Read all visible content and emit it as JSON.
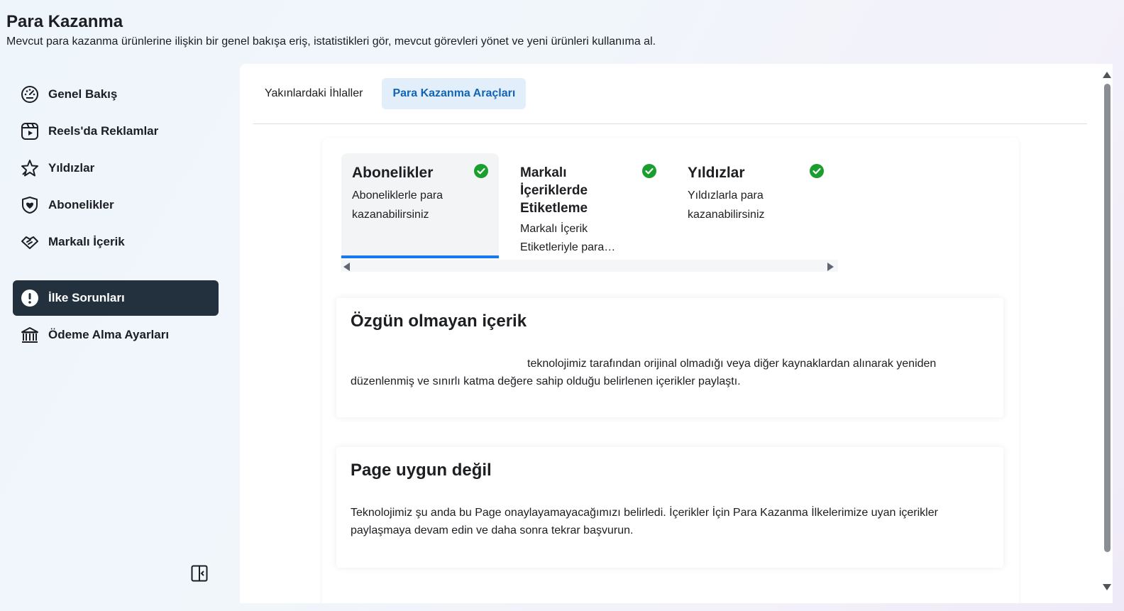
{
  "header": {
    "title": "Para Kazanma",
    "subtitle": "Mevcut para kazanma ürünlerine ilişkin bir genel bakışa eriş, istatistikleri gör, mevcut görevleri yönet ve yeni ürünleri kullanıma al."
  },
  "sidebar": {
    "items": [
      {
        "label": "Genel Bakış",
        "icon": "dashboard-icon"
      },
      {
        "label": "Reels'da Reklamlar",
        "icon": "reels-icon"
      },
      {
        "label": "Yıldızlar",
        "icon": "star-icon"
      },
      {
        "label": "Abonelikler",
        "icon": "heart-shield-icon"
      },
      {
        "label": "Markalı İçerik",
        "icon": "handshake-icon"
      }
    ],
    "secondary": [
      {
        "label": "İlke Sorunları",
        "icon": "alert-icon",
        "active": true
      },
      {
        "label": "Ödeme Alma Ayarları",
        "icon": "bank-icon"
      }
    ]
  },
  "tabs": [
    {
      "label": "Yakınlardaki İhlaller",
      "active": false
    },
    {
      "label": "Para Kazanma Araçları",
      "active": true
    }
  ],
  "products": [
    {
      "title": "Abonelikler",
      "desc": "Aboneliklerle para kazanabilirsiniz",
      "selected": true
    },
    {
      "title": "Markalı İçeriklerde Etiketleme",
      "desc": "Markalı İçerik Etiketleriyle para…",
      "selected": false
    },
    {
      "title": "Yıldızlar",
      "desc": "Yıldızlarla para kazanabilirsiniz",
      "selected": false
    }
  ],
  "issues": [
    {
      "title": "Özgün olmayan içerik",
      "text": "teknolojimiz tarafından orijinal olmadığı veya diğer kaynaklardan alınarak yeniden düzenlenmiş ve sınırlı katma değere sahip olduğu belirlenen içerikler paylaştı."
    },
    {
      "title": "Page uygun değil",
      "text": "Teknolojimiz şu anda bu Page onaylayamayacağımızı belirledi. İçerikler İçin Para Kazanma İlkelerimize uyan içerikler paylaşmaya devam edin ve daha sonra tekrar başvurun."
    }
  ],
  "colors": {
    "accent": "#1877f2",
    "active_nav_bg": "#23313e",
    "active_tab_bg": "#e3eefb",
    "active_tab_text": "#1264b5",
    "check_green": "#1a9e2d"
  }
}
